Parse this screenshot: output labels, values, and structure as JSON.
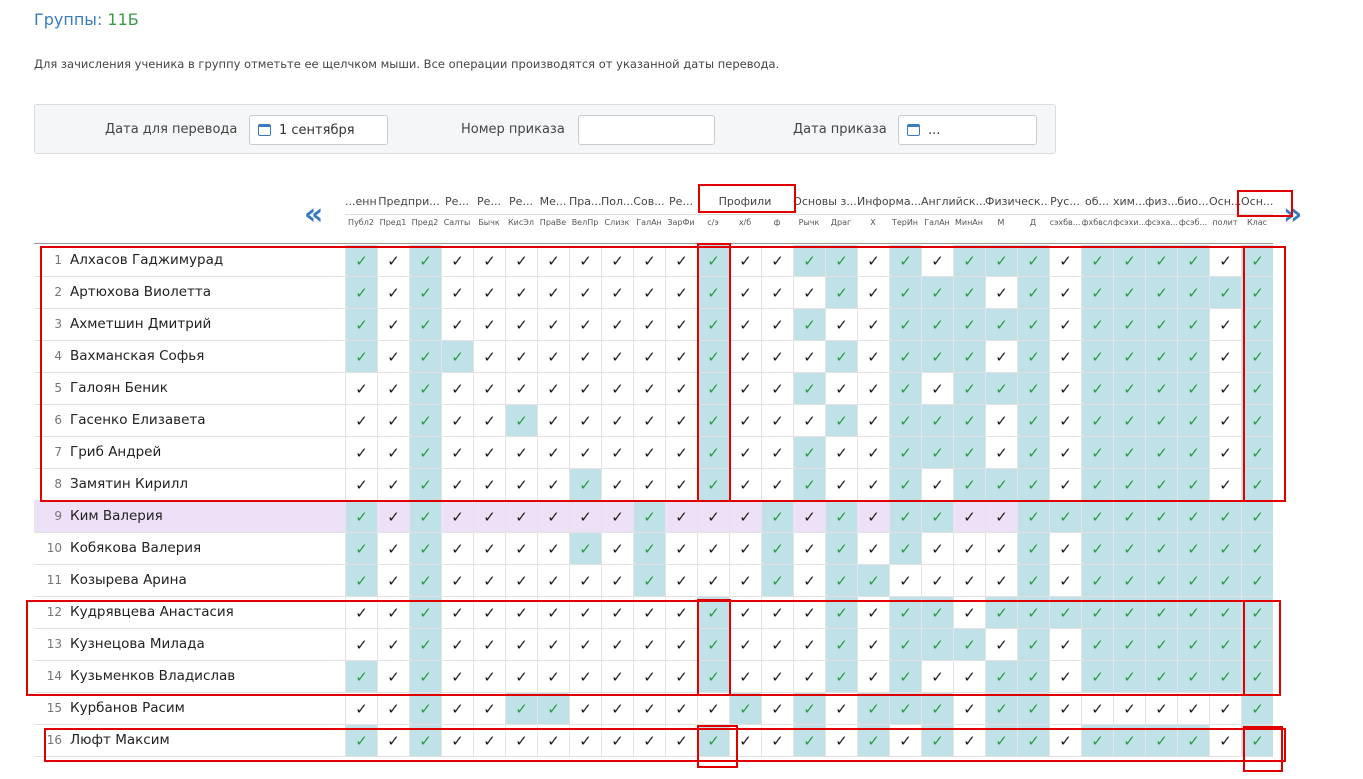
{
  "page": {
    "title_prefix": "Группы:",
    "group": "11Б",
    "hint": "Для зачисления ученика в группу отметьте ее щелчком мыши. Все операции производятся от указанной даты перевода."
  },
  "filter": {
    "date_label": "Дата для перевода",
    "date_value": "1 сентября",
    "order_number_label": "Номер приказа",
    "order_number_value": "",
    "order_date_label": "Дата приказа",
    "order_date_value": "..."
  },
  "nav": {
    "prev": "«",
    "next": "»"
  },
  "check_glyph": "✓",
  "icons": [
    "calendar-icon",
    "chevron-double-left-icon",
    "chevron-double-right-icon",
    "check-icon"
  ],
  "colors": {
    "enrolled_bg": "#bfe1e7",
    "enrolled_check": "#2e9a48",
    "selected_row": "#ece1f6",
    "highlight": "#e00000",
    "accent": "#3a7bbf"
  },
  "columns": [
    {
      "top": "...енно...",
      "sub": "Публ2"
    },
    {
      "top": "Предпри...",
      "sub": "Пред1"
    },
    {
      "top": "",
      "sub": "Пред2"
    },
    {
      "top": "Ре...",
      "sub": "Салты"
    },
    {
      "top": "Ре...",
      "sub": "Бычк"
    },
    {
      "top": "Ре...",
      "sub": "КисЭл"
    },
    {
      "top": "Ме...",
      "sub": "ПраВе"
    },
    {
      "top": "Пра...",
      "sub": "ВелПр"
    },
    {
      "top": "Пол...",
      "sub": "Слизк"
    },
    {
      "top": "Сов...",
      "sub": "ГалАн"
    },
    {
      "top": "Ре...",
      "sub": "ЗарФи"
    },
    {
      "top": "Профили",
      "sub": "с/э"
    },
    {
      "top": "",
      "sub": "х/б"
    },
    {
      "top": "",
      "sub": "ф"
    },
    {
      "top": "Основы з...",
      "sub": "Рычк"
    },
    {
      "top": "",
      "sub": "Драг"
    },
    {
      "top": "Информа...",
      "sub": "Х"
    },
    {
      "top": "",
      "sub": "ТерИн"
    },
    {
      "top": "Английск...",
      "sub": "ГалАн"
    },
    {
      "top": "",
      "sub": "МинАн"
    },
    {
      "top": "Физическ...",
      "sub": "М"
    },
    {
      "top": "",
      "sub": "Д"
    },
    {
      "top": "Рус...",
      "sub": "сэхбв..."
    },
    {
      "top": "об...",
      "sub": "фхбвсл"
    },
    {
      "top": "хим...",
      "sub": "фсэхи..."
    },
    {
      "top": "физ...",
      "sub": "фсэха..."
    },
    {
      "top": "био...",
      "sub": "фсэб..."
    },
    {
      "top": "Осн...",
      "sub": "полит"
    },
    {
      "top": "Осн...",
      "sub": "Клас"
    }
  ],
  "students": [
    {
      "num": "1",
      "name": "Алхасов Гаджимурад",
      "marks": "10100000000100110101110111101"
    },
    {
      "num": "2",
      "name": "Артюхова Виолетта",
      "marks": "10100000000100010111010111111"
    },
    {
      "num": "3",
      "name": "Ахметшин Дмитрий",
      "marks": "10100000000100100111110111101"
    },
    {
      "num": "4",
      "name": "Вахманская Софья",
      "marks": "10110000000100010111010111101"
    },
    {
      "num": "5",
      "name": "Галоян Беник",
      "marks": "00100000000100100101110111101"
    },
    {
      "num": "6",
      "name": "Гасенко Елизавета",
      "marks": "00100100000100010111010111101"
    },
    {
      "num": "7",
      "name": "Гриб Андрей",
      "marks": "00100000000100100111010111101"
    },
    {
      "num": "8",
      "name": "Замятин Кирилл",
      "marks": "00100001000100100101110111101"
    },
    {
      "num": "9",
      "name": "Ким Валерия",
      "marks": "10100000010001010110011111111"
    },
    {
      "num": "10",
      "name": "Кобякова Валерия",
      "marks": "10100001010001010100010111111"
    },
    {
      "num": "11",
      "name": "Козырева Арина",
      "marks": "10100000010001011000010111111"
    },
    {
      "num": "12",
      "name": "Кудрявцева Анастасия",
      "marks": "00100000000100010110111111111"
    },
    {
      "num": "13",
      "name": "Кузнецова Милада",
      "marks": "00100000000100010111010111111"
    },
    {
      "num": "14",
      "name": "Кузьменков Владислав",
      "marks": "10100000000100010100110111111"
    },
    {
      "num": "15",
      "name": "Курбанов Расим",
      "marks": "00100110000010101110110000001"
    },
    {
      "num": "16",
      "name": "Люфт Максим",
      "marks": "10100000000100101010110111101"
    }
  ]
}
